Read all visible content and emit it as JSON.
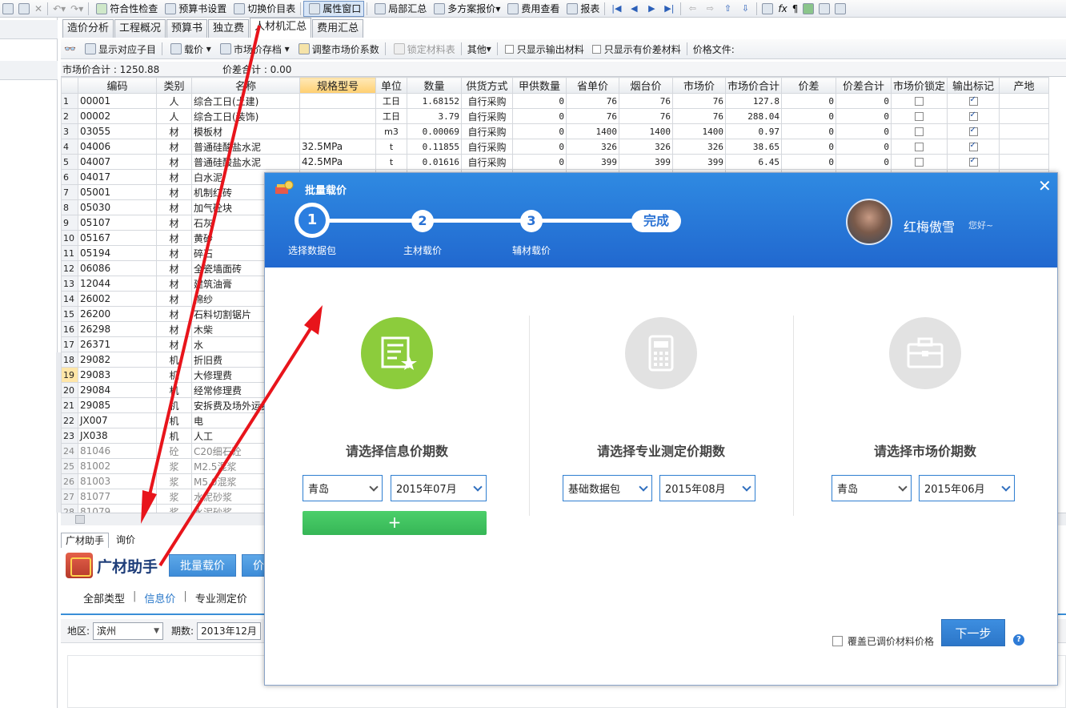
{
  "toolbar": {
    "items": [
      "符合性检查",
      "预算书设置",
      "切换价目表",
      "属性窗口",
      "局部汇总",
      "多方案报价",
      "费用查看",
      "报表"
    ]
  },
  "tabs": [
    "造价分析",
    "工程概况",
    "预算书",
    "独立费",
    "人材机汇总",
    "费用汇总"
  ],
  "active_tab": "人材机汇总",
  "subbar": {
    "show_children": "显示对应子目",
    "load_price": "载价",
    "market_archive": "市场价存档",
    "adjust_coeff": "调整市场价系数",
    "lock_table": "锁定材料表",
    "other": "其他",
    "only_output": "只显示输出材料",
    "only_diff": "只显示有价差材料",
    "price_file": "价格文件:"
  },
  "summary": {
    "market_total": "市场价合计 : 1250.88",
    "diff_total": "价差合计 : 0.00"
  },
  "grid": {
    "headers": [
      "编码",
      "类别",
      "名称",
      "规格型号",
      "单位",
      "数量",
      "供货方式",
      "甲供数量",
      "省单价",
      "烟台价",
      "市场价",
      "市场价合计",
      "价差",
      "价差合计",
      "市场价锁定",
      "输出标记",
      "产地"
    ],
    "rows": [
      {
        "n": "1",
        "code": "00001",
        "type": "人",
        "name": "综合工日(土建)",
        "spec": "",
        "unit": "工日",
        "qty": "1.68152",
        "supply": "自行采购",
        "jia": "0",
        "prov": "76",
        "yt": "76",
        "mkt": "76",
        "total": "127.8",
        "diff": "0",
        "difft": "0",
        "lock": false,
        "out": true
      },
      {
        "n": "2",
        "code": "00002",
        "type": "人",
        "name": "综合工日(装饰)",
        "spec": "",
        "unit": "工日",
        "qty": "3.79",
        "supply": "自行采购",
        "jia": "0",
        "prov": "76",
        "yt": "76",
        "mkt": "76",
        "total": "288.04",
        "diff": "0",
        "difft": "0",
        "lock": false,
        "out": true
      },
      {
        "n": "3",
        "code": "03055",
        "type": "材",
        "name": "模板材",
        "spec": "",
        "unit": "m3",
        "qty": "0.00069",
        "supply": "自行采购",
        "jia": "0",
        "prov": "1400",
        "yt": "1400",
        "mkt": "1400",
        "total": "0.97",
        "diff": "0",
        "difft": "0",
        "lock": false,
        "out": true
      },
      {
        "n": "4",
        "code": "04006",
        "type": "材",
        "name": "普通硅酸盐水泥",
        "spec": "32.5MPa",
        "unit": "t",
        "qty": "0.11855",
        "supply": "自行采购",
        "jia": "0",
        "prov": "326",
        "yt": "326",
        "mkt": "326",
        "total": "38.65",
        "diff": "0",
        "difft": "0",
        "lock": false,
        "out": true
      },
      {
        "n": "5",
        "code": "04007",
        "type": "材",
        "name": "普通硅酸盐水泥",
        "spec": "42.5MPa",
        "unit": "t",
        "qty": "0.01616",
        "supply": "自行采购",
        "jia": "0",
        "prov": "399",
        "yt": "399",
        "mkt": "399",
        "total": "6.45",
        "diff": "0",
        "difft": "0",
        "lock": false,
        "out": true
      },
      {
        "n": "6",
        "code": "04017",
        "type": "材",
        "name": "白水泥"
      },
      {
        "n": "7",
        "code": "05001",
        "type": "材",
        "name": "机制红砖"
      },
      {
        "n": "8",
        "code": "05030",
        "type": "材",
        "name": "加气砼块"
      },
      {
        "n": "9",
        "code": "05107",
        "type": "材",
        "name": "石灰"
      },
      {
        "n": "10",
        "code": "05167",
        "type": "材",
        "name": "黄砂"
      },
      {
        "n": "11",
        "code": "05194",
        "type": "材",
        "name": "碎石"
      },
      {
        "n": "12",
        "code": "06086",
        "type": "材",
        "name": "全瓷墙面砖"
      },
      {
        "n": "13",
        "code": "12044",
        "type": "材",
        "name": "建筑油膏"
      },
      {
        "n": "14",
        "code": "26002",
        "type": "材",
        "name": "棉纱"
      },
      {
        "n": "15",
        "code": "26200",
        "type": "材",
        "name": "石料切割锯片"
      },
      {
        "n": "16",
        "code": "26298",
        "type": "材",
        "name": "木柴"
      },
      {
        "n": "17",
        "code": "26371",
        "type": "材",
        "name": "水"
      },
      {
        "n": "18",
        "code": "29082",
        "type": "机",
        "name": "折旧费"
      },
      {
        "n": "19",
        "code": "29083",
        "type": "机",
        "name": "大修理费"
      },
      {
        "n": "20",
        "code": "29084",
        "type": "机",
        "name": "经常修理费"
      },
      {
        "n": "21",
        "code": "29085",
        "type": "机",
        "name": "安拆费及场外运费"
      },
      {
        "n": "22",
        "code": "JX007",
        "type": "机",
        "name": "电"
      },
      {
        "n": "23",
        "code": "JX038",
        "type": "机",
        "name": "人工"
      },
      {
        "n": "24",
        "code": "81046",
        "type": "砼",
        "name": "C20细石砼",
        "grey": true
      },
      {
        "n": "25",
        "code": "81002",
        "type": "浆",
        "name": "M2.5混浆",
        "grey": true
      },
      {
        "n": "26",
        "code": "81003",
        "type": "浆",
        "name": "M5.0混浆",
        "grey": true
      },
      {
        "n": "27",
        "code": "81077",
        "type": "浆",
        "name": "水泥砂浆",
        "grey": true
      },
      {
        "n": "28",
        "code": "81079",
        "type": "浆",
        "name": "水泥砂浆",
        "grey": true
      }
    ]
  },
  "bottom_tabs": [
    "广材助手",
    "询价"
  ],
  "gc": {
    "title": "广材助手",
    "batch_btn": "批量载价",
    "second_btn": "价",
    "filter_tabs": [
      "全部类型",
      "信息价",
      "专业测定价"
    ],
    "region_label": "地区:",
    "region_value": "滨州",
    "period_label": "期数:",
    "period_value": "2013年12月"
  },
  "dialog": {
    "title": "批量载价",
    "steps": [
      "1",
      "2",
      "3"
    ],
    "done": "完成",
    "step_labels": [
      "选择数据包",
      "主材载价",
      "辅材载价"
    ],
    "user_name": "红梅傲雪",
    "greeting": "您好~",
    "columns": [
      {
        "title": "请选择信息价期数",
        "sel1": "青岛",
        "sel2": "2015年07月"
      },
      {
        "title": "请选择专业测定价期数",
        "sel1": "基础数据包",
        "sel2": "2015年08月"
      },
      {
        "title": "请选择市场价期数",
        "sel1": "青岛",
        "sel2": "2015年06月"
      }
    ],
    "add_label": "+",
    "cover_label": "覆盖已调价材料价格",
    "next_label": "下一步",
    "help": "?",
    "close": "✕"
  },
  "colors": {
    "dialog_blue": "#2168cf",
    "green": "#8ccc3c",
    "arrow_red": "#e8141b"
  }
}
